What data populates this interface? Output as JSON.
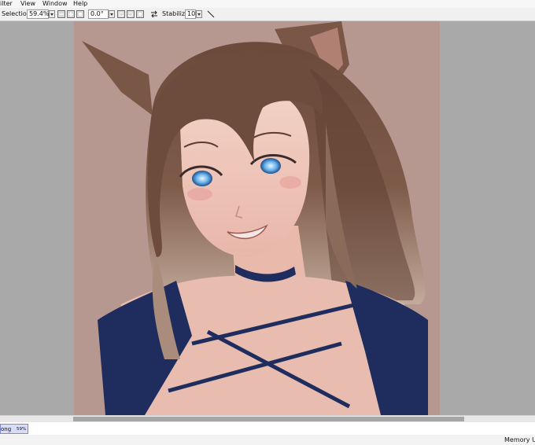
{
  "menu": {
    "items": [
      {
        "label": "Filter",
        "shown": "ilter"
      },
      {
        "label": "View"
      },
      {
        "label": "Window"
      },
      {
        "label": "Help"
      }
    ]
  },
  "toolbar": {
    "selection_label": "Selection",
    "zoom_value": "59.4%",
    "rotation_value": "0.0°",
    "stabilizer_label": "Stabilizer",
    "stabilizer_value": "10"
  },
  "navigator": {
    "label": "ong",
    "percent": "59%"
  },
  "status": {
    "memory_label": "Memory Usa"
  },
  "colors": {
    "canvas_bg": "#b79890",
    "workspace_bg": "#a9a9a9",
    "navigator_highlight": "#d9dcf6"
  },
  "canvas": {
    "content": "illustration of a girl with brown hair, cat ears, blue eyes, navy choker and navy top"
  }
}
